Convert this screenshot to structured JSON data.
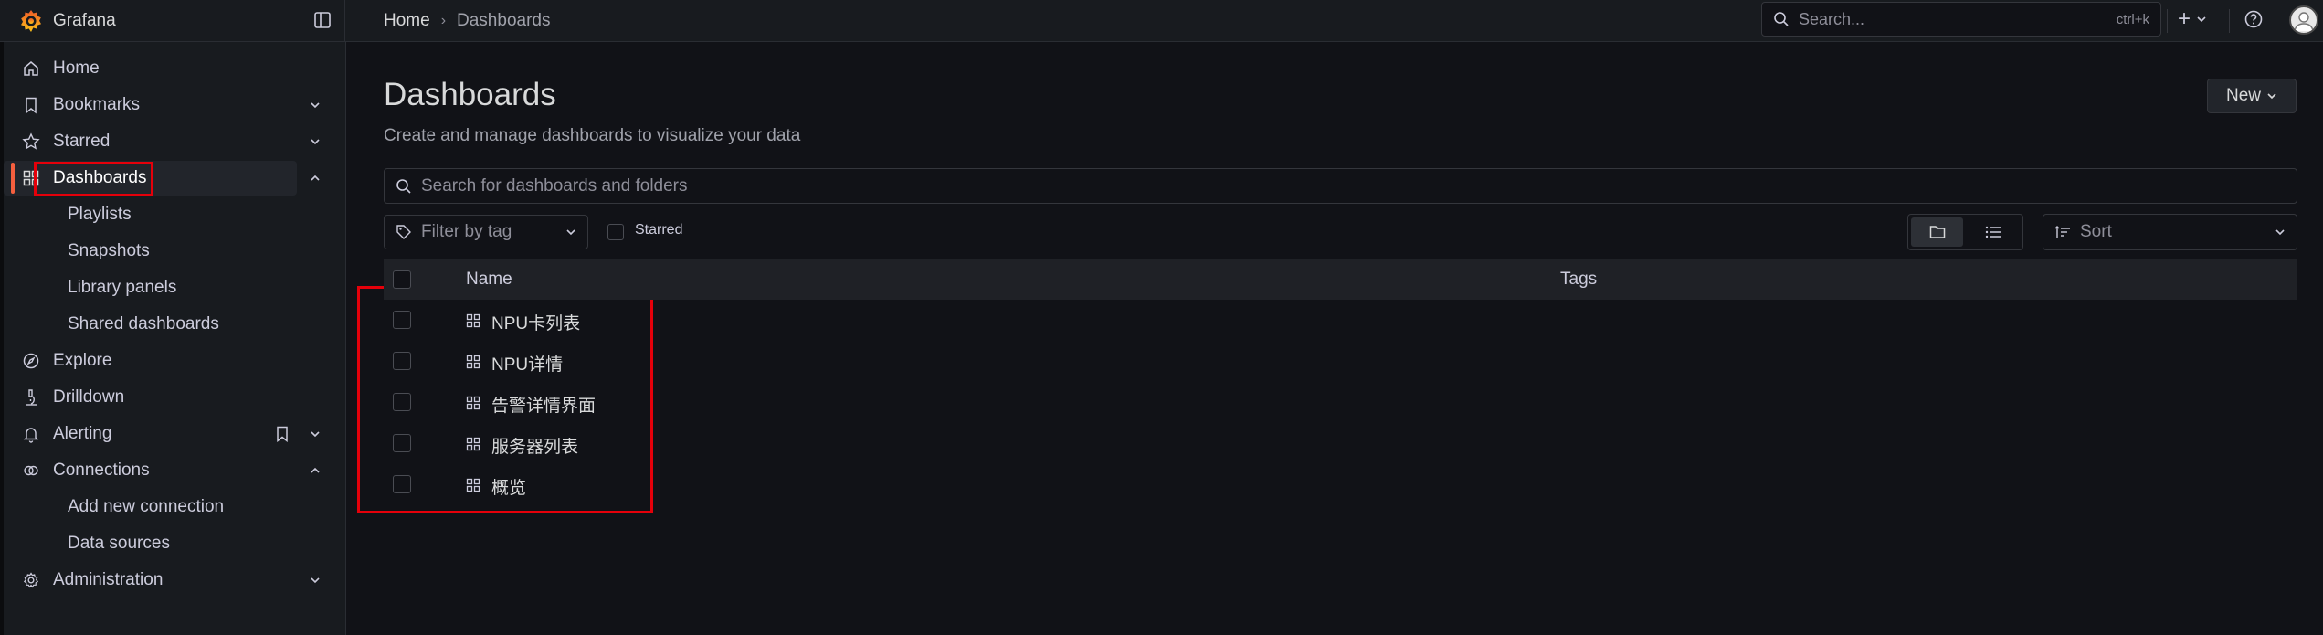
{
  "app": {
    "title": "Grafana"
  },
  "breadcrumb": {
    "home": "Home",
    "separator": "›",
    "current": "Dashboards"
  },
  "topbar": {
    "search_placeholder": "Search...",
    "search_shortcut": "ctrl+k",
    "add_label": "+"
  },
  "sidebar": {
    "items": [
      {
        "label": "Home",
        "icon": "home-icon"
      },
      {
        "label": "Bookmarks",
        "icon": "bookmark-icon"
      },
      {
        "label": "Starred",
        "icon": "star-icon"
      },
      {
        "label": "Dashboards",
        "icon": "apps-icon"
      },
      {
        "label": "Explore",
        "icon": "compass-icon"
      },
      {
        "label": "Drilldown",
        "icon": "microscope-icon"
      },
      {
        "label": "Alerting",
        "icon": "bell-icon"
      },
      {
        "label": "Connections",
        "icon": "link-icon"
      },
      {
        "label": "Administration",
        "icon": "cog-icon"
      }
    ],
    "dashboards_children": [
      "Playlists",
      "Snapshots",
      "Library panels",
      "Shared dashboards"
    ],
    "connections_children": [
      "Add new connection",
      "Data sources"
    ]
  },
  "page": {
    "title": "Dashboards",
    "subtitle": "Create and manage dashboards to visualize your data",
    "new_button": "New"
  },
  "filters": {
    "search_placeholder": "Search for dashboards and folders",
    "tag_placeholder": "Filter by tag",
    "starred_label": "Starred",
    "sort_placeholder": "Sort"
  },
  "table": {
    "columns": [
      "Name",
      "Tags"
    ],
    "rows": [
      "NPU卡列表",
      "NPU详情",
      "告警详情界面",
      "服务器列表",
      "概览"
    ]
  },
  "colors": {
    "accent": "#f55f3e",
    "highlight": "#e5000a",
    "background": "#111217",
    "panel": "#181b1f"
  }
}
